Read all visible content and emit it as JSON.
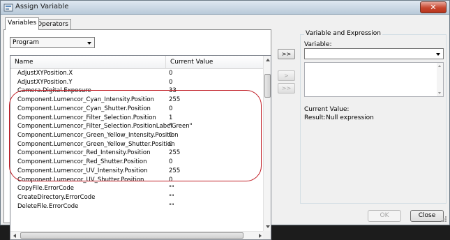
{
  "window": {
    "title": "Assign Variable",
    "close_glyph": "✕"
  },
  "tabs": [
    {
      "label": "Variables",
      "active": true
    },
    {
      "label": "Operators",
      "active": false
    }
  ],
  "scope_select": {
    "value": "Program"
  },
  "table": {
    "columns": [
      "Name",
      "Current Value"
    ],
    "rows": [
      {
        "name": "AdjustXYPosition.X",
        "value": "0"
      },
      {
        "name": "AdjustXYPosition.Y",
        "value": "0"
      },
      {
        "name": "Camera.Digital.Exposure",
        "value": "33"
      },
      {
        "name": "Component.Lumencor_Cyan_Intensity.Position",
        "value": "255"
      },
      {
        "name": "Component.Lumencor_Cyan_Shutter.Position",
        "value": "0"
      },
      {
        "name": "Component.Lumencor_Filter_Selection.Position",
        "value": "1"
      },
      {
        "name": "Component.Lumencor_Filter_Selection.PositionLabel",
        "value": "\"Green\""
      },
      {
        "name": "Component.Lumencor_Green_Yellow_Intensity.Position",
        "value": "0"
      },
      {
        "name": "Component.Lumencor_Green_Yellow_Shutter.Position",
        "value": "0"
      },
      {
        "name": "Component.Lumencor_Red_Intensity.Position",
        "value": "255"
      },
      {
        "name": "Component.Lumencor_Red_Shutter.Position",
        "value": "0"
      },
      {
        "name": "Component.Lumencor_UV_Intensity.Position",
        "value": "255"
      },
      {
        "name": "Component.Lumencor_UV_Shutter.Position",
        "value": "0"
      },
      {
        "name": "CopyFile.ErrorCode",
        "value": "\"\""
      },
      {
        "name": "CreateDirectory.ErrorCode",
        "value": "\"\""
      },
      {
        "name": "DeleteFile.ErrorCode",
        "value": "\"\""
      }
    ]
  },
  "transfer_buttons": {
    "add_all": ">>",
    "add_one": ">",
    "remove_all": ">>"
  },
  "expression_panel": {
    "group_title": "Variable and Expression",
    "variable_label": "Variable:",
    "variable_value": "",
    "expression_text": "",
    "current_value_label": "Current Value:",
    "result_label": "Result:",
    "result_value": "Null expression"
  },
  "footer": {
    "ok_label": "OK",
    "close_label": "Close"
  },
  "colors": {
    "highlight_oval": "#c01c24",
    "titlebar": "#b9cad9",
    "close_button": "#c7462e"
  }
}
